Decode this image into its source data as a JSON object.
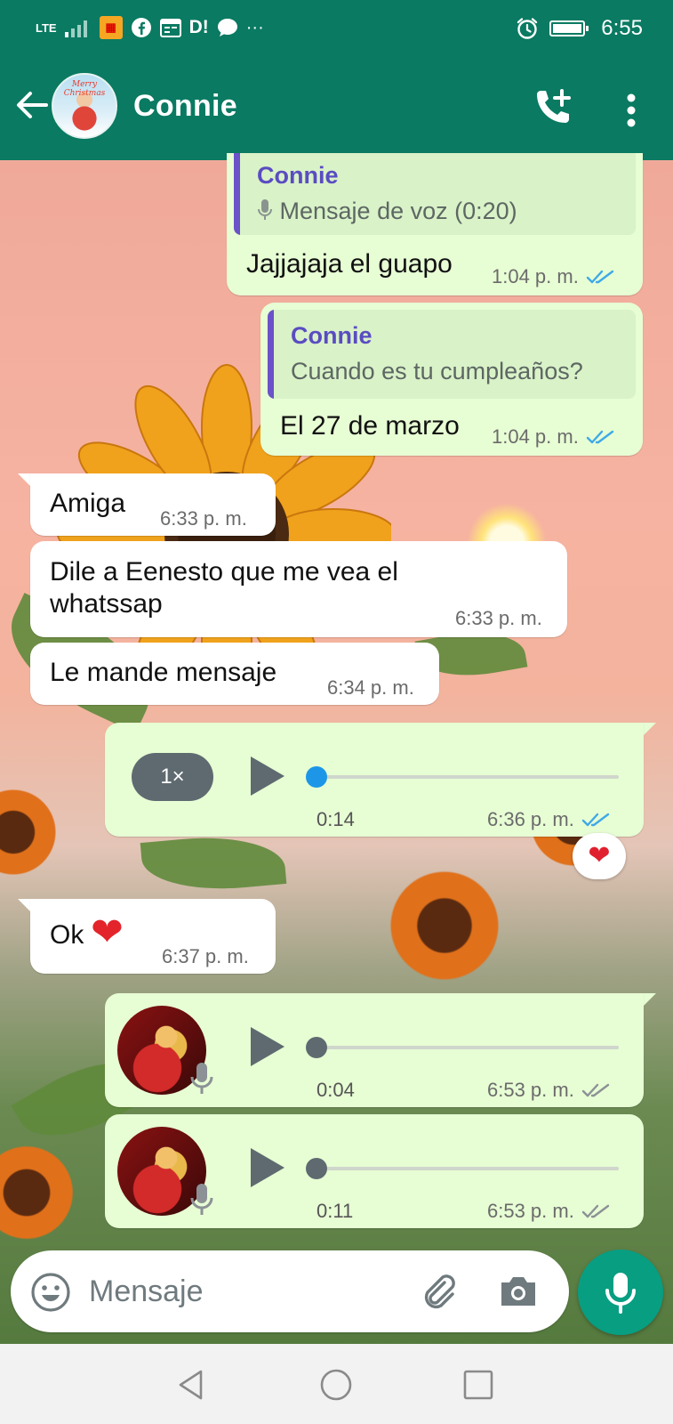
{
  "status_bar": {
    "network": "LTE",
    "notification_apps": [
      "D!"
    ],
    "more_indicator": "···",
    "time": "6:55"
  },
  "header": {
    "contact_name": "Connie",
    "avatar_caption": "Merry Christmas"
  },
  "messages": [
    {
      "direction": "out",
      "quote_author": "Connie",
      "quote_text": "Mensaje de voz (0:20)",
      "text": "Jajjajaja el guapo",
      "time": "1:04 p. m.",
      "status": "read"
    },
    {
      "direction": "out",
      "quote_author": "Connie",
      "quote_text": "Cuando es tu cumpleaños?",
      "text": "El 27 de marzo",
      "time": "1:04 p. m.",
      "status": "read"
    },
    {
      "direction": "in",
      "text": "Amiga",
      "time": "6:33 p. m."
    },
    {
      "direction": "in",
      "text_line1": "Dile a Eenesto que me vea el",
      "text_line2": "whatssap",
      "time": "6:33 p. m."
    },
    {
      "direction": "in",
      "text": "Le mande mensaje",
      "time": "6:34 p. m."
    },
    {
      "direction": "out",
      "type": "voice",
      "speed": "1×",
      "duration": "0:14",
      "progress": 0,
      "time": "6:36 p. m.",
      "status": "read",
      "reaction": "❤"
    },
    {
      "direction": "in",
      "text": "Ok",
      "emoji": "❤",
      "time": "6:37 p. m."
    },
    {
      "direction": "out",
      "type": "voice",
      "duration": "0:04",
      "progress": 0,
      "time": "6:53 p. m.",
      "status": "delivered"
    },
    {
      "direction": "out",
      "type": "voice",
      "duration": "0:11",
      "progress": 0,
      "time": "6:53 p. m.",
      "status": "delivered"
    }
  ],
  "composer": {
    "placeholder": "Mensaje"
  },
  "colors": {
    "header": "#0a7a62",
    "outgoing_bubble": "#e7fdd4",
    "incoming_bubble": "#ffffff",
    "read_ticks": "#3fa9e8",
    "delivered_ticks": "#8c9196",
    "mic_button": "#089e82"
  }
}
